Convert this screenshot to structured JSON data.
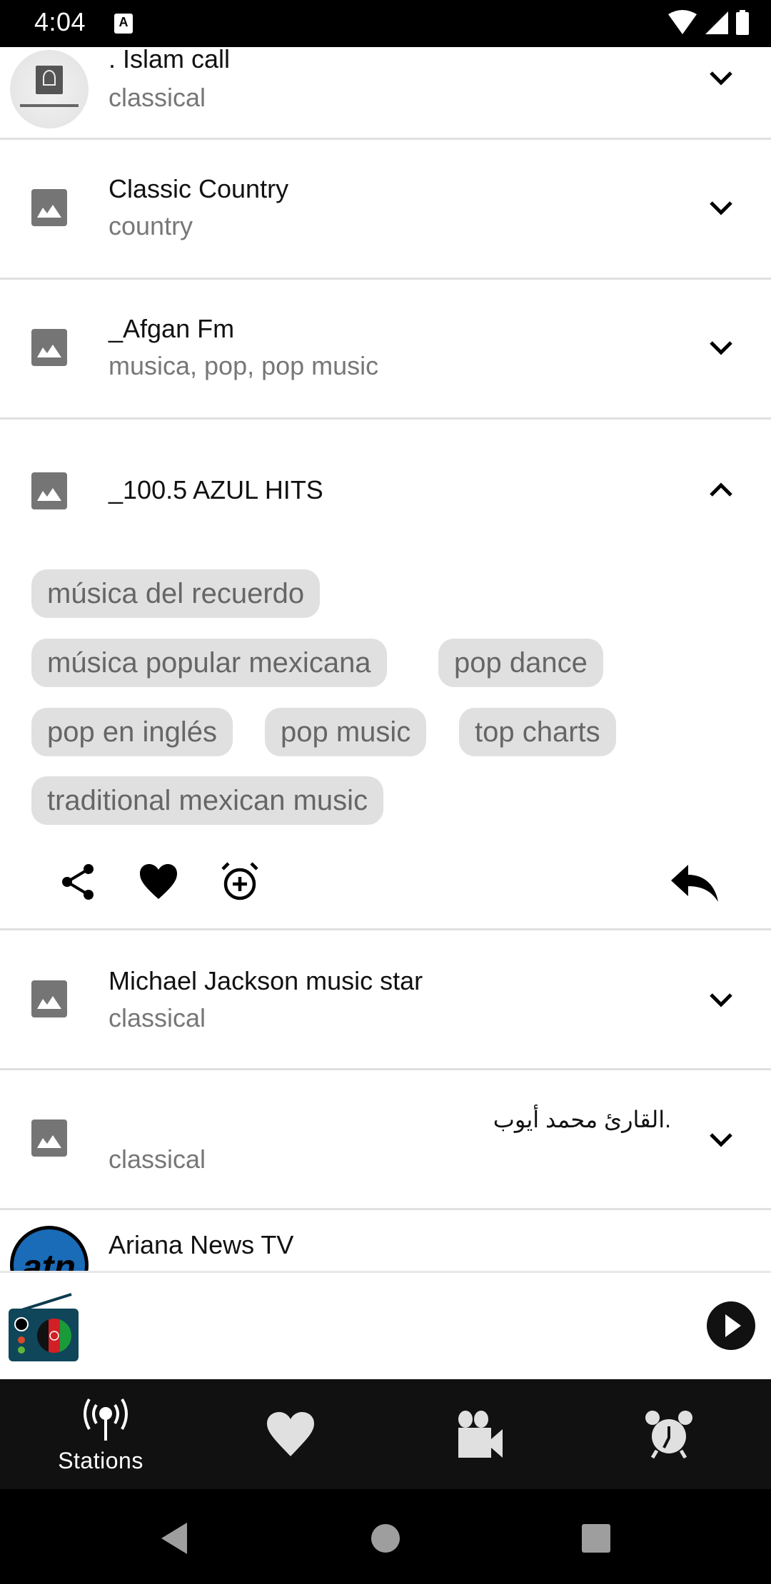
{
  "status_bar": {
    "time": "4:04",
    "notification_icon": "a-icon",
    "icons": [
      "wifi-icon",
      "signal-icon",
      "battery-icon"
    ]
  },
  "stations": [
    {
      "name": ". Islam call",
      "genre": "classical",
      "thumbnail": "islam-call-logo",
      "expanded": false
    },
    {
      "name": "Classic Country",
      "genre": "country",
      "thumbnail": "image-placeholder-icon",
      "expanded": false
    },
    {
      "name": "_Afgan Fm",
      "genre": "musica, pop, pop music",
      "thumbnail": "image-placeholder-icon",
      "expanded": false
    },
    {
      "name": "_100.5 AZUL HITS",
      "genre": "",
      "thumbnail": "image-placeholder-icon",
      "expanded": true,
      "tags": [
        "música del recuerdo",
        "música popular mexicana",
        "pop dance",
        "pop en inglés",
        "pop music",
        "top charts",
        "traditional mexican music"
      ],
      "actions": [
        "share-icon",
        "favorite-icon",
        "add-alarm-icon",
        "reply-icon"
      ]
    },
    {
      "name": "Michael Jackson music star",
      "genre": "classical",
      "thumbnail": "image-placeholder-icon",
      "expanded": false
    },
    {
      "name": ".القارئ محمد أيوب",
      "genre": "classical",
      "thumbnail": "image-placeholder-icon",
      "expanded": false
    },
    {
      "name": "Ariana News TV",
      "genre": "",
      "thumbnail": "atn-logo",
      "expanded": false
    }
  ],
  "mini_player": {
    "art": "afghan-radio-logo",
    "play_icon": "play-icon"
  },
  "bottom_nav": {
    "items": [
      {
        "label": "Stations",
        "icon": "radio-tower-icon",
        "active": true
      },
      {
        "label": "",
        "icon": "heart-icon",
        "active": false
      },
      {
        "label": "",
        "icon": "video-camera-icon",
        "active": false
      },
      {
        "label": "",
        "icon": "alarm-clock-icon",
        "active": false
      }
    ]
  },
  "system_nav": [
    "back-button",
    "home-button",
    "recents-button"
  ],
  "colors": {
    "divider": "#e0e0e0",
    "chip_bg": "#e0e0e0",
    "chip_text": "#666666",
    "subtitle": "#777777",
    "bottom_nav_bg": "#111111",
    "placeholder_icon": "#757575"
  }
}
